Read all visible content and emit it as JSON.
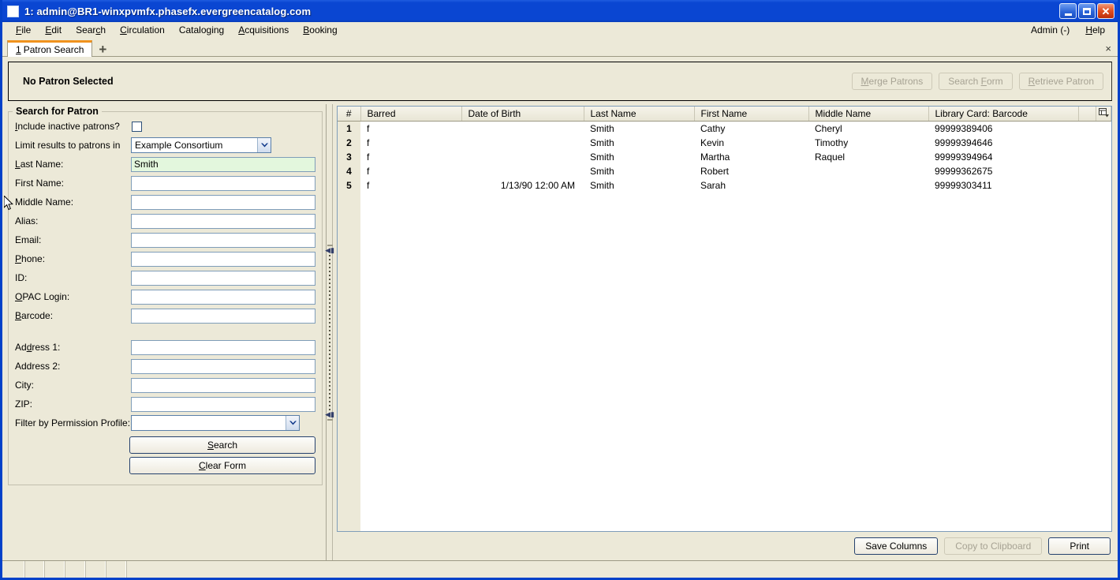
{
  "window": {
    "title": "1: admin@BR1-winxpvmfx.phasefx.evergreencatalog.com",
    "minimize_label": "Minimize",
    "maximize_label": "Maximize",
    "close_label": "Close"
  },
  "menubar": {
    "items": [
      {
        "label": "File",
        "accel": "F"
      },
      {
        "label": "Edit",
        "accel": "E"
      },
      {
        "label": "Search",
        "accel": "c"
      },
      {
        "label": "Circulation",
        "accel": "C"
      },
      {
        "label": "Cataloging",
        "accel": "g"
      },
      {
        "label": "Acquisitions",
        "accel": "A"
      },
      {
        "label": "Booking",
        "accel": "B"
      }
    ],
    "admin_label": "Admin (-)",
    "help_label": "Help"
  },
  "tabs": {
    "items": [
      {
        "number": "1",
        "label": "Patron Search",
        "active": true
      }
    ],
    "new_tab_label": "+",
    "close_label": "×"
  },
  "patron_bar": {
    "title": "No Patron Selected",
    "merge_patrons_label": "Merge Patrons",
    "search_form_label": "Search Form",
    "retrieve_patron_label": "Retrieve Patron"
  },
  "search_form": {
    "legend": "Search for Patron",
    "include_inactive_label": "Include inactive patrons?",
    "include_inactive_checked": false,
    "limit_results_label": "Limit results to patrons in",
    "limit_results_value": "Example Consortium",
    "fields": [
      {
        "label": "Last Name:",
        "value": "Smith",
        "focused": true
      },
      {
        "label": "First Name:",
        "value": "",
        "focused": false
      },
      {
        "label": "Middle Name:",
        "value": "",
        "focused": false
      },
      {
        "label": "Alias:",
        "value": "",
        "focused": false
      },
      {
        "label": "Email:",
        "value": "",
        "focused": false
      },
      {
        "label": "Phone:",
        "value": "",
        "focused": false
      },
      {
        "label": "ID:",
        "value": "",
        "focused": false
      },
      {
        "label": "OPAC Login:",
        "value": "",
        "focused": false
      },
      {
        "label": "Barcode:",
        "value": "",
        "focused": false
      }
    ],
    "address_fields": [
      {
        "label": "Address 1:",
        "value": ""
      },
      {
        "label": "Address 2:",
        "value": ""
      },
      {
        "label": "City:",
        "value": ""
      },
      {
        "label": "ZIP:",
        "value": ""
      }
    ],
    "permission_profile_label": "Filter by Permission Profile:",
    "permission_profile_value": "",
    "search_button_label": "Search",
    "clear_form_button_label": "Clear Form"
  },
  "results": {
    "columns": [
      "#",
      "Barred",
      "Date of Birth",
      "Last Name",
      "First Name",
      "Middle Name",
      "Library Card: Barcode"
    ],
    "rows": [
      {
        "num": "1",
        "barred": "f",
        "dob": "",
        "last": "Smith",
        "first": "Cathy",
        "middle": "Cheryl",
        "barcode": "99999389406"
      },
      {
        "num": "2",
        "barred": "f",
        "dob": "",
        "last": "Smith",
        "first": "Kevin",
        "middle": "Timothy",
        "barcode": "99999394646"
      },
      {
        "num": "3",
        "barred": "f",
        "dob": "",
        "last": "Smith",
        "first": "Martha",
        "middle": "Raquel",
        "barcode": "99999394964"
      },
      {
        "num": "4",
        "barred": "f",
        "dob": "",
        "last": "Smith",
        "first": "Robert",
        "middle": "",
        "barcode": "99999362675"
      },
      {
        "num": "5",
        "barred": "f",
        "dob": "1/13/90 12:00 AM",
        "last": "Smith",
        "first": "Sarah",
        "middle": "",
        "barcode": "99999303411"
      }
    ],
    "column_picker_name": "column-picker-icon",
    "save_columns_label": "Save Columns",
    "copy_to_clipboard_label": "Copy to Clipboard",
    "print_label": "Print"
  },
  "colors": {
    "titlebar_blue": "#0a46d2",
    "window_border_blue": "#0341c9",
    "chrome_beige": "#ece9d8",
    "active_tab_accent": "#f0921e",
    "focused_field_green": "#e3f7dd",
    "disabled_text": "#a6a293"
  }
}
